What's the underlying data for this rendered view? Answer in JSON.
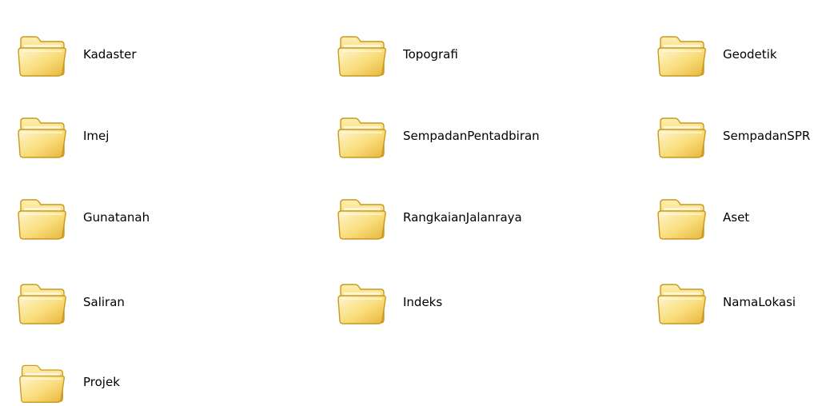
{
  "folders": [
    {
      "label": "Kadaster",
      "icon": "folder-icon"
    },
    {
      "label": "Topografi",
      "icon": "folder-icon"
    },
    {
      "label": "Geodetik",
      "icon": "folder-icon"
    },
    {
      "label": "Imej",
      "icon": "folder-icon"
    },
    {
      "label": "SempadanPentadbiran",
      "icon": "folder-icon"
    },
    {
      "label": "SempadanSPR",
      "icon": "folder-icon"
    },
    {
      "label": "Gunatanah",
      "icon": "folder-icon"
    },
    {
      "label": "RangkaianJalanraya",
      "icon": "folder-icon"
    },
    {
      "label": "Aset",
      "icon": "folder-icon"
    },
    {
      "label": "Saliran",
      "icon": "folder-icon"
    },
    {
      "label": "Indeks",
      "icon": "folder-icon"
    },
    {
      "label": "NamaLokasi",
      "icon": "folder-icon"
    },
    {
      "label": "Projek",
      "icon": "folder-icon"
    }
  ],
  "colors": {
    "folder_front": "#f7d76b",
    "folder_back": "#e8b83a",
    "folder_outline": "#c9981e",
    "background": "#ffffff"
  }
}
